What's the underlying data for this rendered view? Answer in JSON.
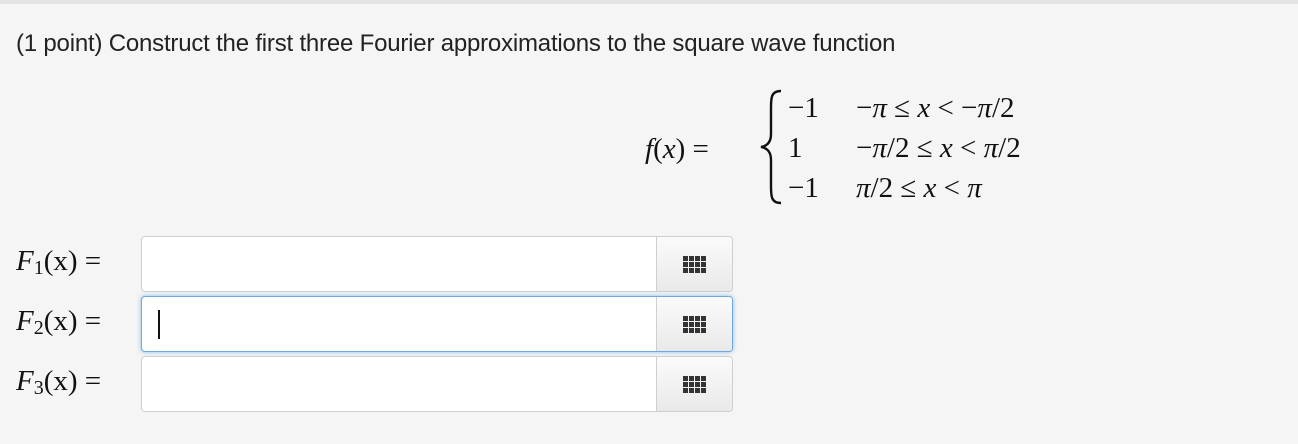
{
  "problem": {
    "text": "(1 point) Construct the first three Fourier approximations to the square wave function"
  },
  "function": {
    "lhs": "f(x) =",
    "cases": [
      {
        "value": "−1",
        "condition": "−π ≤ x < −π/2"
      },
      {
        "value": "1",
        "condition": "−π/2 ≤ x < π/2"
      },
      {
        "value": "−1",
        "condition": "π/2 ≤ x < π"
      }
    ]
  },
  "answers": [
    {
      "name": "F",
      "sub": "1",
      "suffix": "(x) =",
      "value": "",
      "focused": false,
      "palette_icon": "grid-icon"
    },
    {
      "name": "F",
      "sub": "2",
      "suffix": "(x) =",
      "value": "",
      "focused": true,
      "palette_icon": "grid-icon"
    },
    {
      "name": "F",
      "sub": "3",
      "suffix": "(x) =",
      "value": "",
      "focused": false,
      "palette_icon": "grid-icon"
    }
  ],
  "colors": {
    "background": "#f5f5f5",
    "focus_border": "#6ea8dc"
  }
}
